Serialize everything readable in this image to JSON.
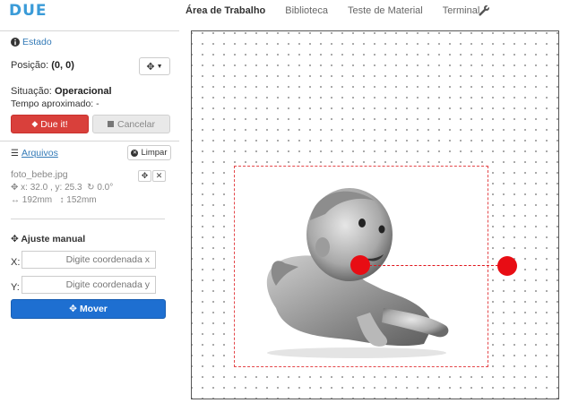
{
  "app": {
    "logo": "DUE"
  },
  "nav": {
    "items": [
      "Área de Trabalho",
      "Biblioteca",
      "Teste de Material",
      "Terminal"
    ],
    "settings_icon": "wrench-icon"
  },
  "status": {
    "title": "Estado",
    "position_label": "Posição:",
    "position_value": "(0, 0)",
    "situation_label": "Situação:",
    "situation_value": "Operacional",
    "time_label": "Tempo aproximado:",
    "time_value": "-",
    "due_button": "Due it!",
    "cancel_button": "Cancelar"
  },
  "files": {
    "title": "Arquivos",
    "clear_button": "Limpar",
    "items": [
      {
        "name": "foto_bebe.jpg",
        "x": "x: 32.0",
        "y": "y: 25.3",
        "rotation": "0.0°",
        "width": "192mm",
        "height": "152mm"
      }
    ]
  },
  "manual": {
    "title": "Ajuste manual",
    "x_label": "X:",
    "y_label": "Y:",
    "x_placeholder": "Digite coordenada x",
    "y_placeholder": "Digite coordenada y",
    "move_button": "Mover"
  },
  "colors": {
    "accent": "#337ab7",
    "danger": "#d9403b",
    "primary": "#1e6fd1",
    "marker": "#e80d14"
  }
}
